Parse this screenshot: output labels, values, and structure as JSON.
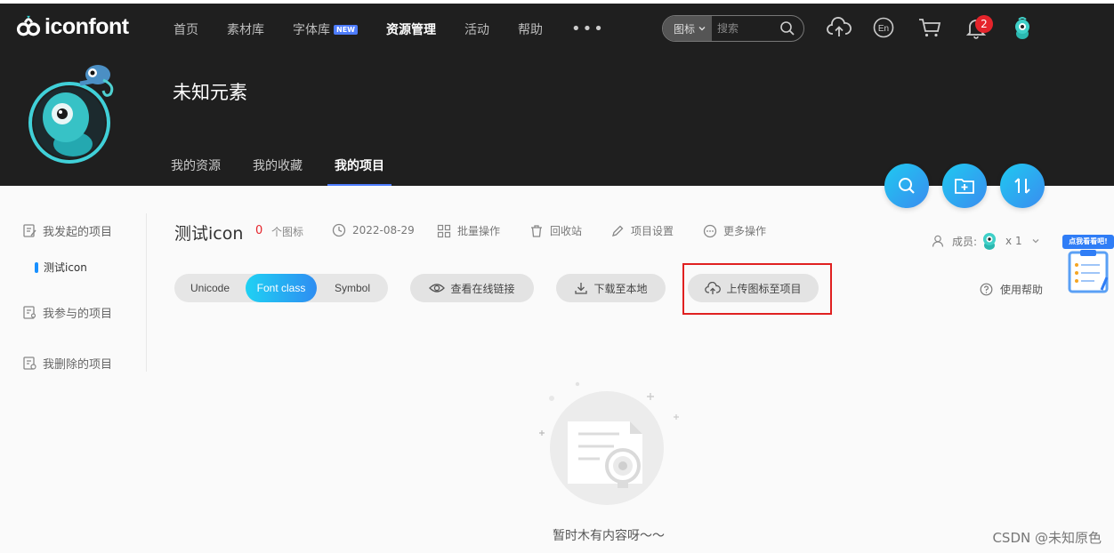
{
  "brand": {
    "name": "iconfont"
  },
  "nav": {
    "items": [
      {
        "label": "首页"
      },
      {
        "label": "素材库"
      },
      {
        "label": "字体库",
        "badge": "NEW"
      },
      {
        "label": "资源管理",
        "active": true
      },
      {
        "label": "活动"
      },
      {
        "label": "帮助"
      }
    ],
    "more": "•••",
    "search": {
      "type": "图标",
      "placeholder": "搜索"
    },
    "notifications": "2",
    "icons": [
      "upload-cloud-icon",
      "language-en-icon",
      "cart-icon",
      "bell-icon",
      "avatar"
    ]
  },
  "profile": {
    "name": "未知元素",
    "tabs": [
      {
        "label": "我的资源"
      },
      {
        "label": "我的收藏"
      },
      {
        "label": "我的项目",
        "active": true
      }
    ]
  },
  "sidebar": {
    "items": [
      {
        "label": "我发起的项目",
        "icon": "edit-doc-icon"
      },
      {
        "label": "我参与的项目",
        "icon": "doc-user-icon"
      },
      {
        "label": "我删除的项目",
        "icon": "doc-delete-icon"
      }
    ],
    "active_project": "测试icon"
  },
  "project": {
    "title": "测试icon",
    "icon_count": "0",
    "icon_count_unit": "个图标",
    "date": "2022-08-29",
    "actions": [
      {
        "label": "批量操作",
        "icon": "grid-icon"
      },
      {
        "label": "回收站",
        "icon": "trash-icon"
      },
      {
        "label": "项目设置",
        "icon": "pencil-icon"
      },
      {
        "label": "更多操作",
        "icon": "more-circle-icon"
      }
    ],
    "members_label": "成员:",
    "members_count": "x 1"
  },
  "toolbar": {
    "modes": [
      "Unicode",
      "Font class",
      "Symbol"
    ],
    "active_mode": "Font class",
    "view_link": "查看在线链接",
    "download": "下载至本地",
    "upload": "上传图标至项目",
    "help": "使用帮助"
  },
  "empty": {
    "message": "暂时木有内容呀～～"
  },
  "float_widget": {
    "label": "点我看看吧!"
  },
  "watermark": "CSDN @未知原色",
  "colors": {
    "accent": "#2e8df2",
    "highlight_border": "#e02020",
    "count_red": "#e5242b",
    "dark_header": "#1f1f1f"
  }
}
